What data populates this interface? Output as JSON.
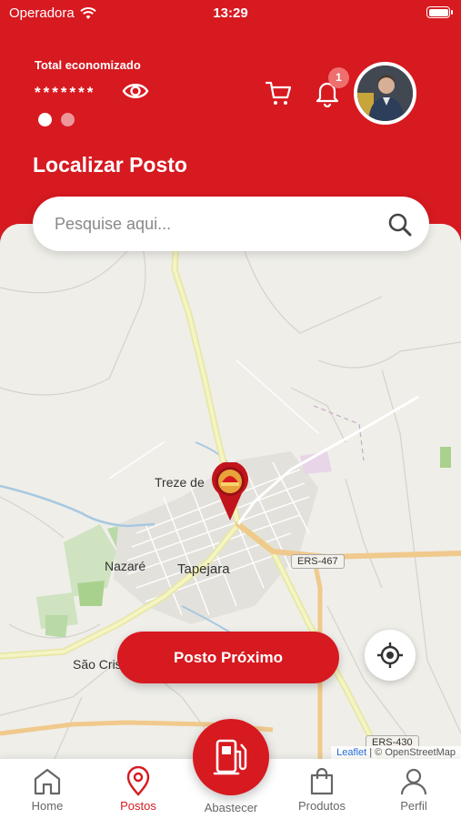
{
  "status_bar": {
    "carrier": "Operadora",
    "time": "13:29"
  },
  "header": {
    "saved_label": "Total economizado",
    "saved_value": "*******",
    "notification_count": "1",
    "page_title": "Localizar Posto"
  },
  "search": {
    "placeholder": "Pesquise aqui..."
  },
  "map": {
    "places": [
      "Treze de",
      "Nazaré",
      "Tapejara",
      "São Cris"
    ],
    "roads": [
      "ERS-467",
      "ERS-430"
    ],
    "attribution_link": "Leaflet",
    "attribution_text": " | © OpenStreetMap"
  },
  "actions": {
    "nearest_label": "Posto Próximo"
  },
  "tabbar": {
    "home": "Home",
    "stations": "Postos",
    "refuel": "Abastecer",
    "products": "Produtos",
    "profile": "Perfil"
  },
  "colors": {
    "brand": "#d71920",
    "badge": "#ef6f6f",
    "map_bg": "#efeee9"
  }
}
